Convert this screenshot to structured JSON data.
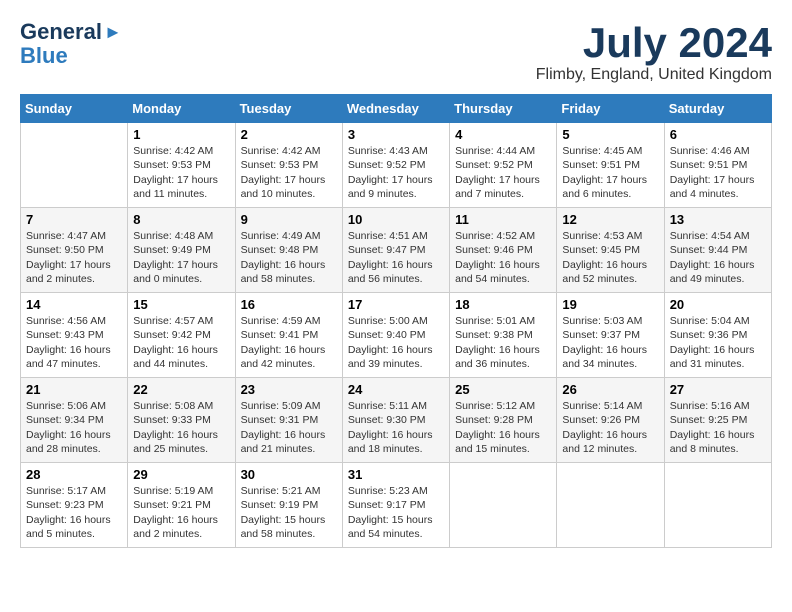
{
  "logo": {
    "line1": "General",
    "line2": "Blue"
  },
  "header": {
    "month": "July 2024",
    "location": "Flimby, England, United Kingdom"
  },
  "weekdays": [
    "Sunday",
    "Monday",
    "Tuesday",
    "Wednesday",
    "Thursday",
    "Friday",
    "Saturday"
  ],
  "weeks": [
    [
      {
        "day": "",
        "info": ""
      },
      {
        "day": "1",
        "info": "Sunrise: 4:42 AM\nSunset: 9:53 PM\nDaylight: 17 hours\nand 11 minutes."
      },
      {
        "day": "2",
        "info": "Sunrise: 4:42 AM\nSunset: 9:53 PM\nDaylight: 17 hours\nand 10 minutes."
      },
      {
        "day": "3",
        "info": "Sunrise: 4:43 AM\nSunset: 9:52 PM\nDaylight: 17 hours\nand 9 minutes."
      },
      {
        "day": "4",
        "info": "Sunrise: 4:44 AM\nSunset: 9:52 PM\nDaylight: 17 hours\nand 7 minutes."
      },
      {
        "day": "5",
        "info": "Sunrise: 4:45 AM\nSunset: 9:51 PM\nDaylight: 17 hours\nand 6 minutes."
      },
      {
        "day": "6",
        "info": "Sunrise: 4:46 AM\nSunset: 9:51 PM\nDaylight: 17 hours\nand 4 minutes."
      }
    ],
    [
      {
        "day": "7",
        "info": "Sunrise: 4:47 AM\nSunset: 9:50 PM\nDaylight: 17 hours\nand 2 minutes."
      },
      {
        "day": "8",
        "info": "Sunrise: 4:48 AM\nSunset: 9:49 PM\nDaylight: 17 hours\nand 0 minutes."
      },
      {
        "day": "9",
        "info": "Sunrise: 4:49 AM\nSunset: 9:48 PM\nDaylight: 16 hours\nand 58 minutes."
      },
      {
        "day": "10",
        "info": "Sunrise: 4:51 AM\nSunset: 9:47 PM\nDaylight: 16 hours\nand 56 minutes."
      },
      {
        "day": "11",
        "info": "Sunrise: 4:52 AM\nSunset: 9:46 PM\nDaylight: 16 hours\nand 54 minutes."
      },
      {
        "day": "12",
        "info": "Sunrise: 4:53 AM\nSunset: 9:45 PM\nDaylight: 16 hours\nand 52 minutes."
      },
      {
        "day": "13",
        "info": "Sunrise: 4:54 AM\nSunset: 9:44 PM\nDaylight: 16 hours\nand 49 minutes."
      }
    ],
    [
      {
        "day": "14",
        "info": "Sunrise: 4:56 AM\nSunset: 9:43 PM\nDaylight: 16 hours\nand 47 minutes."
      },
      {
        "day": "15",
        "info": "Sunrise: 4:57 AM\nSunset: 9:42 PM\nDaylight: 16 hours\nand 44 minutes."
      },
      {
        "day": "16",
        "info": "Sunrise: 4:59 AM\nSunset: 9:41 PM\nDaylight: 16 hours\nand 42 minutes."
      },
      {
        "day": "17",
        "info": "Sunrise: 5:00 AM\nSunset: 9:40 PM\nDaylight: 16 hours\nand 39 minutes."
      },
      {
        "day": "18",
        "info": "Sunrise: 5:01 AM\nSunset: 9:38 PM\nDaylight: 16 hours\nand 36 minutes."
      },
      {
        "day": "19",
        "info": "Sunrise: 5:03 AM\nSunset: 9:37 PM\nDaylight: 16 hours\nand 34 minutes."
      },
      {
        "day": "20",
        "info": "Sunrise: 5:04 AM\nSunset: 9:36 PM\nDaylight: 16 hours\nand 31 minutes."
      }
    ],
    [
      {
        "day": "21",
        "info": "Sunrise: 5:06 AM\nSunset: 9:34 PM\nDaylight: 16 hours\nand 28 minutes."
      },
      {
        "day": "22",
        "info": "Sunrise: 5:08 AM\nSunset: 9:33 PM\nDaylight: 16 hours\nand 25 minutes."
      },
      {
        "day": "23",
        "info": "Sunrise: 5:09 AM\nSunset: 9:31 PM\nDaylight: 16 hours\nand 21 minutes."
      },
      {
        "day": "24",
        "info": "Sunrise: 5:11 AM\nSunset: 9:30 PM\nDaylight: 16 hours\nand 18 minutes."
      },
      {
        "day": "25",
        "info": "Sunrise: 5:12 AM\nSunset: 9:28 PM\nDaylight: 16 hours\nand 15 minutes."
      },
      {
        "day": "26",
        "info": "Sunrise: 5:14 AM\nSunset: 9:26 PM\nDaylight: 16 hours\nand 12 minutes."
      },
      {
        "day": "27",
        "info": "Sunrise: 5:16 AM\nSunset: 9:25 PM\nDaylight: 16 hours\nand 8 minutes."
      }
    ],
    [
      {
        "day": "28",
        "info": "Sunrise: 5:17 AM\nSunset: 9:23 PM\nDaylight: 16 hours\nand 5 minutes."
      },
      {
        "day": "29",
        "info": "Sunrise: 5:19 AM\nSunset: 9:21 PM\nDaylight: 16 hours\nand 2 minutes."
      },
      {
        "day": "30",
        "info": "Sunrise: 5:21 AM\nSunset: 9:19 PM\nDaylight: 15 hours\nand 58 minutes."
      },
      {
        "day": "31",
        "info": "Sunrise: 5:23 AM\nSunset: 9:17 PM\nDaylight: 15 hours\nand 54 minutes."
      },
      {
        "day": "",
        "info": ""
      },
      {
        "day": "",
        "info": ""
      },
      {
        "day": "",
        "info": ""
      }
    ]
  ]
}
